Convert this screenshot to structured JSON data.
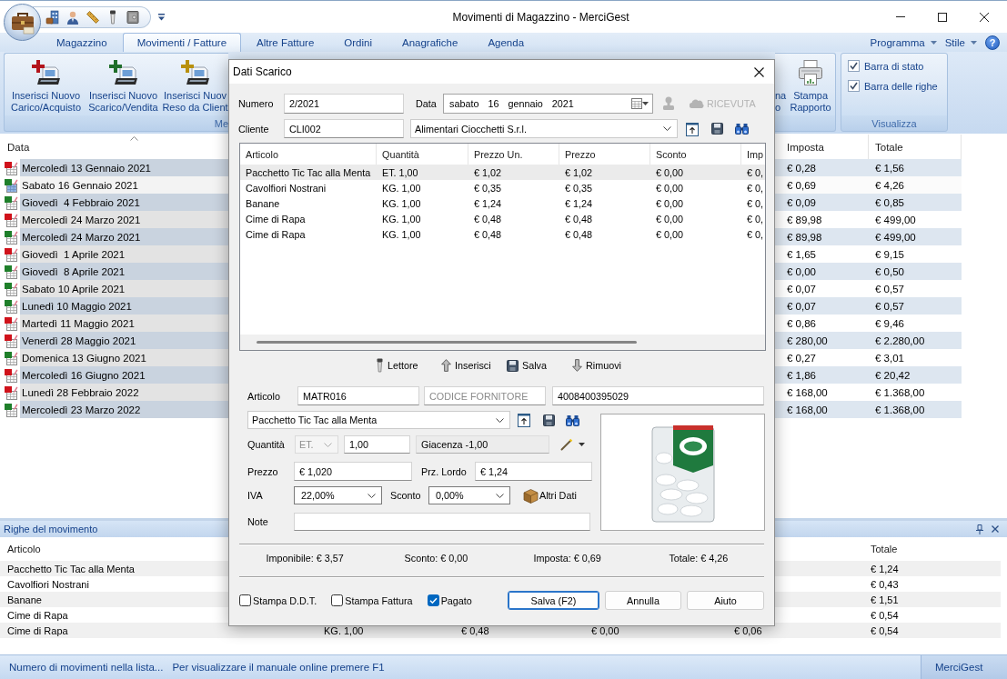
{
  "window": {
    "title": "Movimenti di Magazzino - MerciGest"
  },
  "ribbon": {
    "tabs": [
      {
        "label": "Magazzino",
        "selected": false
      },
      {
        "label": "Movimenti / Fatture",
        "selected": true
      },
      {
        "label": "Altre Fatture",
        "selected": false
      },
      {
        "label": "Ordini",
        "selected": false
      },
      {
        "label": "Anagrafiche",
        "selected": false
      },
      {
        "label": "Agenda",
        "selected": false
      }
    ],
    "menus": [
      "Programma",
      "Stile"
    ],
    "help": "?",
    "groups": [
      {
        "label": "Me",
        "buttons": [
          {
            "kind": "add",
            "color": "#b3141c",
            "lines": [
              "Inserisci Nuovo",
              "Carico/Acquisto"
            ]
          },
          {
            "kind": "add",
            "color": "#1f6e2a",
            "lines": [
              "Inserisci Nuovo",
              "Scarico/Vendita"
            ]
          },
          {
            "kind": "add",
            "color": "#b8900c",
            "lines": [
              "Inserisci Nuov",
              "Reso da Client"
            ]
          }
        ]
      },
      {
        "buttons": [
          {
            "kind": "text",
            "lines": [
              "na",
              "o"
            ]
          },
          {
            "kind": "print",
            "lines": [
              "Stampa",
              "Rapporto"
            ]
          }
        ]
      },
      {
        "label": "Visualizza",
        "checkboxes": [
          {
            "label": "Barra di stato",
            "checked": true
          },
          {
            "label": "Barra delle righe",
            "checked": true
          }
        ]
      }
    ]
  },
  "movements": {
    "columns": [
      {
        "label": "Data",
        "sorted": true
      },
      {
        "label": "Imposta",
        "sorted": false
      },
      {
        "label": "Totale",
        "sorted": false
      }
    ],
    "rows": [
      {
        "cells": [
          "Mercoledì 13 Gennaio 2021",
          "€ 0,28",
          "€ 1,56"
        ],
        "color": "#d0121b",
        "selected": false
      },
      {
        "cells": [
          "Sabato 16 Gennaio 2021",
          "€ 0,69",
          "€ 4,26"
        ],
        "color": "#1f7f2a",
        "selected": true
      },
      {
        "cells": [
          "Giovedì  4 Febbraio 2021",
          "€ 0,09",
          "€ 0,85"
        ],
        "color": "#1f7f2a",
        "selected": false
      },
      {
        "cells": [
          "Mercoledì 24 Marzo 2021",
          "€ 89,98",
          "€ 499,00"
        ],
        "color": "#d0121b",
        "selected": false
      },
      {
        "cells": [
          "Mercoledì 24 Marzo 2021",
          "€ 89,98",
          "€ 499,00"
        ],
        "color": "#1f7f2a",
        "selected": false
      },
      {
        "cells": [
          "Giovedì  1 Aprile 2021",
          "€ 1,65",
          "€ 9,15"
        ],
        "color": "#d0121b",
        "selected": false
      },
      {
        "cells": [
          "Giovedì  8 Aprile 2021",
          "€ 0,00",
          "€ 0,50"
        ],
        "color": "#1f7f2a",
        "selected": false
      },
      {
        "cells": [
          "Sabato 10 Aprile 2021",
          "€ 0,07",
          "€ 0,57"
        ],
        "color": "#1f7f2a",
        "selected": false
      },
      {
        "cells": [
          "Lunedì 10 Maggio 2021",
          "€ 0,07",
          "€ 0,57"
        ],
        "color": "#1f7f2a",
        "selected": false
      },
      {
        "cells": [
          "Martedì 11 Maggio 2021",
          "€ 0,86",
          "€ 9,46"
        ],
        "color": "#d0121b",
        "selected": false
      },
      {
        "cells": [
          "Venerdì 28 Maggio 2021",
          "€ 280,00",
          "€ 2.280,00"
        ],
        "color": "#d0121b",
        "selected": false
      },
      {
        "cells": [
          "Domenica 13 Giugno 2021",
          "€ 0,27",
          "€ 3,01"
        ],
        "color": "#1f7f2a",
        "selected": false
      },
      {
        "cells": [
          "Mercoledì 16 Giugno 2021",
          "€ 1,86",
          "€ 20,42"
        ],
        "color": "#d0121b",
        "selected": false
      },
      {
        "cells": [
          "Lunedì 28 Febbraio 2022",
          "€ 168,00",
          "€ 1.368,00"
        ],
        "color": "#d0121b",
        "selected": false
      },
      {
        "cells": [
          "Mercoledì 23 Marzo 2022",
          "€ 168,00",
          "€ 1.368,00"
        ],
        "color": "#1f7f2a",
        "selected": false
      }
    ]
  },
  "lines_panel": {
    "title": "Righe del movimento",
    "columns": [
      "Articolo",
      "Totale"
    ],
    "rows": [
      {
        "articolo": "Pacchetto Tic Tac alla Menta",
        "totale": "€ 1,24"
      },
      {
        "articolo": "Cavolfiori Nostrani",
        "totale": "€ 0,43"
      },
      {
        "articolo": "Banane",
        "totale": "€ 1,51"
      },
      {
        "articolo": "Cime di Rapa",
        "totale": "€ 0,54"
      },
      {
        "articolo": "Cime di Rapa",
        "column_2": "KG. 1,00",
        "column_3": "€ 0,48",
        "column_4": "€ 0,00",
        "column_5": "€ 0,06",
        "totale": "€ 0,54"
      }
    ]
  },
  "status_bar": {
    "messages": [
      "Numero di movimenti nella lista...",
      "Per visualizzare il manuale online premere F1"
    ],
    "app_name": "MerciGest"
  },
  "dialog": {
    "title": "Dati Scarico",
    "numero": {
      "label": "Numero",
      "value": "2/2021"
    },
    "data": {
      "label": "Data",
      "value": "sabato 16 gennaio 2021"
    },
    "stamp_button": {
      "disabled": true
    },
    "receipt_button": {
      "label": "RICEVUTA",
      "disabled": true
    },
    "cliente": {
      "label": "Cliente",
      "code": "CLI002",
      "name": "Alimentari Ciocchetti S.r.l."
    },
    "grid": {
      "columns": [
        "Articolo",
        "Quantità",
        "Prezzo Un.",
        "Prezzo",
        "Sconto",
        "Imp"
      ],
      "rows": [
        {
          "cells": [
            "Pacchetto Tic Tac alla Menta",
            "ET. 1,00",
            "€ 1,02",
            "€ 1,02",
            "€ 0,00",
            "€ 0,"
          ],
          "selected": true
        },
        {
          "cells": [
            "Cavolfiori Nostrani",
            "KG. 1,00",
            "€ 0,35",
            "€ 0,35",
            "€ 0,00",
            "€ 0,"
          ],
          "selected": false
        },
        {
          "cells": [
            "Banane",
            "KG. 1,00",
            "€ 1,24",
            "€ 1,24",
            "€ 0,00",
            "€ 0,"
          ],
          "selected": false
        },
        {
          "cells": [
            "Cime di Rapa",
            "KG. 1,00",
            "€ 0,48",
            "€ 0,48",
            "€ 0,00",
            "€ 0,"
          ],
          "selected": false
        },
        {
          "cells": [
            "Cime di Rapa",
            "KG. 1,00",
            "€ 0,48",
            "€ 0,48",
            "€ 0,00",
            "€ 0,"
          ],
          "selected": false
        }
      ]
    },
    "toolbar": [
      {
        "kind": "scanner",
        "label": "Lettore"
      },
      {
        "kind": "up",
        "label": "Inserisci"
      },
      {
        "kind": "save",
        "label": "Salva"
      },
      {
        "kind": "down",
        "label": "Rimuovi"
      }
    ],
    "articolo": {
      "label": "Articolo",
      "code": "MATR016",
      "supplier_code": {
        "placeholder": "CODICE FORNITORE"
      },
      "barcode": "4008400395029",
      "description": "Pacchetto Tic Tac alla Menta"
    },
    "quantita": {
      "label": "Quantità",
      "unit": {
        "value": "ET.",
        "disabled": true
      },
      "value": "1,00",
      "stock": "Giacenza -1,00"
    },
    "prezzo": {
      "label": "Prezzo",
      "value": "€ 1,020",
      "lordo_label": "Prz. Lordo",
      "lordo_value": "€ 1,24"
    },
    "iva": {
      "label": "IVA",
      "value": "22,00%"
    },
    "sconto": {
      "label": "Sconto",
      "value": "0,00%"
    },
    "other_data_button": "Altri Dati",
    "note": {
      "label": "Note"
    },
    "totals": [
      "Imponibile: € 3,57",
      "Sconto: € 0,00",
      "Imposta: € 0,69",
      "Totale: € 4,26"
    ],
    "options": [
      {
        "label": "Stampa D.D.T.",
        "checked": false
      },
      {
        "label": "Stampa Fattura",
        "checked": false
      },
      {
        "label": "Pagato",
        "checked": true
      }
    ],
    "buttons": [
      {
        "label": "Salva (F2)",
        "default": true
      },
      {
        "label": "Annulla",
        "default": false
      },
      {
        "label": "Aiuto",
        "default": false
      }
    ]
  }
}
